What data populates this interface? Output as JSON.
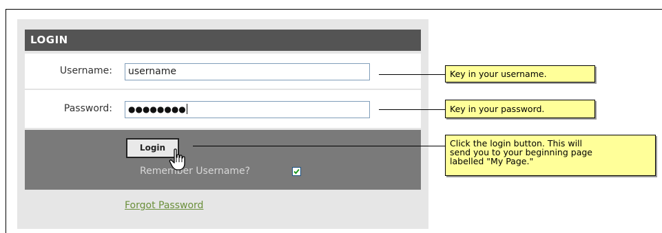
{
  "login_panel": {
    "title": "LOGIN",
    "username_label": "Username:",
    "username_value": "username",
    "password_label": "Password:",
    "password_mask": "●●●●●●●●",
    "login_button": "Login",
    "remember_label": "Remember Username?",
    "remember_checked": true,
    "forgot_link": "Forgot Password"
  },
  "callouts": {
    "username": "Key in your username.",
    "password": "Key in your password.",
    "login_line1": "Click the login button. This will",
    "login_line2": "send you to your  beginning page",
    "login_line3": "labelled \"My Page.\""
  },
  "colors": {
    "header_bg": "#545454",
    "action_bg": "#7a7a7a",
    "callout_bg": "#ffff99",
    "link": "#6a8f3a"
  },
  "icons": [
    "hand-cursor-icon",
    "checkmark-icon"
  ]
}
